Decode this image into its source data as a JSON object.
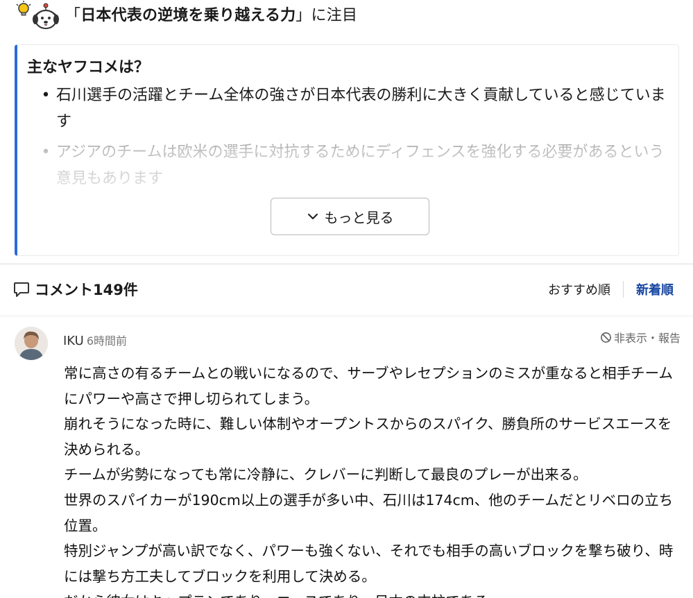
{
  "header": {
    "title_prefix": "「",
    "title_emphasis": "日本代表の逆境を乗り越える力",
    "title_suffix": "」に注目"
  },
  "summary": {
    "heading": "主なヤフコメは？",
    "bullets": [
      "石川選手の活躍とチーム全体の強さが日本代表の勝利に大きく貢献していると感じています",
      "アジアのチームは欧米の選手に対抗するためにディフェンスを強化する必要があるという意見もあります"
    ],
    "bullet_glyph": "•",
    "more_button_label": "もっと見る"
  },
  "comments_section": {
    "title": "コメント149件",
    "sort_options": [
      {
        "label": "おすすめ順",
        "active": false
      },
      {
        "label": "新着順",
        "active": true
      }
    ]
  },
  "comment": {
    "author": "IKU",
    "time": "6時間前",
    "report_label": "非表示・報告",
    "body_lines": [
      "常に高さの有るチームとの戦いになるので、サーブやレセプションのミスが重なると相手チームにパワーや高さで押し切られてしまう。",
      "崩れそうになった時に、難しい体制やオープントスからのスパイク、勝負所のサービスエースを決められる。",
      "チームが劣勢になっても常に冷静に、クレバーに判断して最良のプレーが出来る。",
      "世界のスパイカーが190cm以上の選手が多い中、石川は174cm、他のチームだとリベロの立ち位置。",
      "特別ジャンプが高い訳でなく、パワーも強くない、それでも相手の高いブロックを撃ち破り、時には撃ち方工夫してブロックを利用して決める。",
      "だから彼女はキャプテンであり、エースであり、日本の支柱である。"
    ]
  },
  "icons": {
    "mascot": "mascot-dog-headphones-icon",
    "lightbulb": "lightbulb-icon",
    "chevron": "chevron-down-icon",
    "comment": "comment-bubble-icon",
    "report": "ban-icon"
  },
  "colors": {
    "accent_blue": "#2b6bd6",
    "active_sort": "#1746a2",
    "text": "#1a1a1a"
  }
}
